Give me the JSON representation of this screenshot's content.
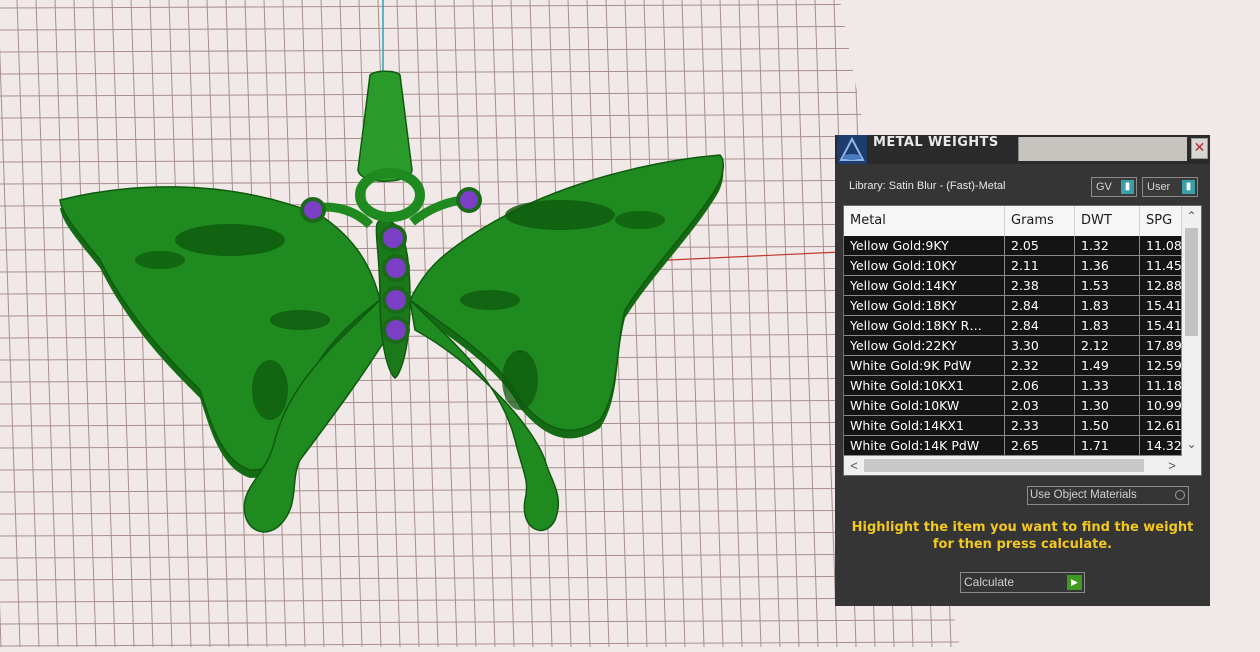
{
  "window": {
    "title": "METAL WEIGHTS",
    "close_glyph": "✕",
    "logo_icon": "app-logo-icon"
  },
  "library": {
    "label": "Library: Satin Blur - (Fast)-Metal",
    "gv_select": "GV",
    "user_select": "User",
    "dropdown_glyph": "▮"
  },
  "table": {
    "columns": [
      "Metal",
      "Grams",
      "DWT",
      "SPG"
    ],
    "rows": [
      [
        "Yellow Gold:9KY",
        "2.05",
        "1.32",
        "11.08"
      ],
      [
        "Yellow Gold:10KY",
        "2.11",
        "1.36",
        "11.45"
      ],
      [
        "Yellow Gold:14KY",
        "2.38",
        "1.53",
        "12.88"
      ],
      [
        "Yellow Gold:18KY",
        "2.84",
        "1.83",
        "15.41"
      ],
      [
        "Yellow Gold:18KY R…",
        "2.84",
        "1.83",
        "15.41"
      ],
      [
        "Yellow Gold:22KY",
        "3.30",
        "2.12",
        "17.89"
      ],
      [
        "White Gold:9K PdW",
        "2.32",
        "1.49",
        "12.59"
      ],
      [
        "White Gold:10KX1",
        "2.06",
        "1.33",
        "11.18"
      ],
      [
        "White Gold:10KW",
        "2.03",
        "1.30",
        "10.99"
      ],
      [
        "White Gold:14KX1",
        "2.33",
        "1.50",
        "12.61"
      ],
      [
        "White Gold:14K PdW",
        "2.65",
        "1.71",
        "14.32"
      ]
    ],
    "scroll_up": "⌃",
    "scroll_down": "⌄",
    "scroll_left": "<",
    "scroll_right": ">"
  },
  "options": {
    "use_object_materials": "Use Object Materials"
  },
  "hint": {
    "line1": "Highlight the item you want to find the weight",
    "line2": "for then press calculate."
  },
  "actions": {
    "calculate": "Calculate",
    "calculate_arrow": "▶"
  },
  "viewport": {
    "model": "butterfly pendant",
    "model_color": "#1f8a1f",
    "gem_color": "#7a3fc4",
    "grid_color": "#a88f8f",
    "background": "#f1e8e8"
  }
}
